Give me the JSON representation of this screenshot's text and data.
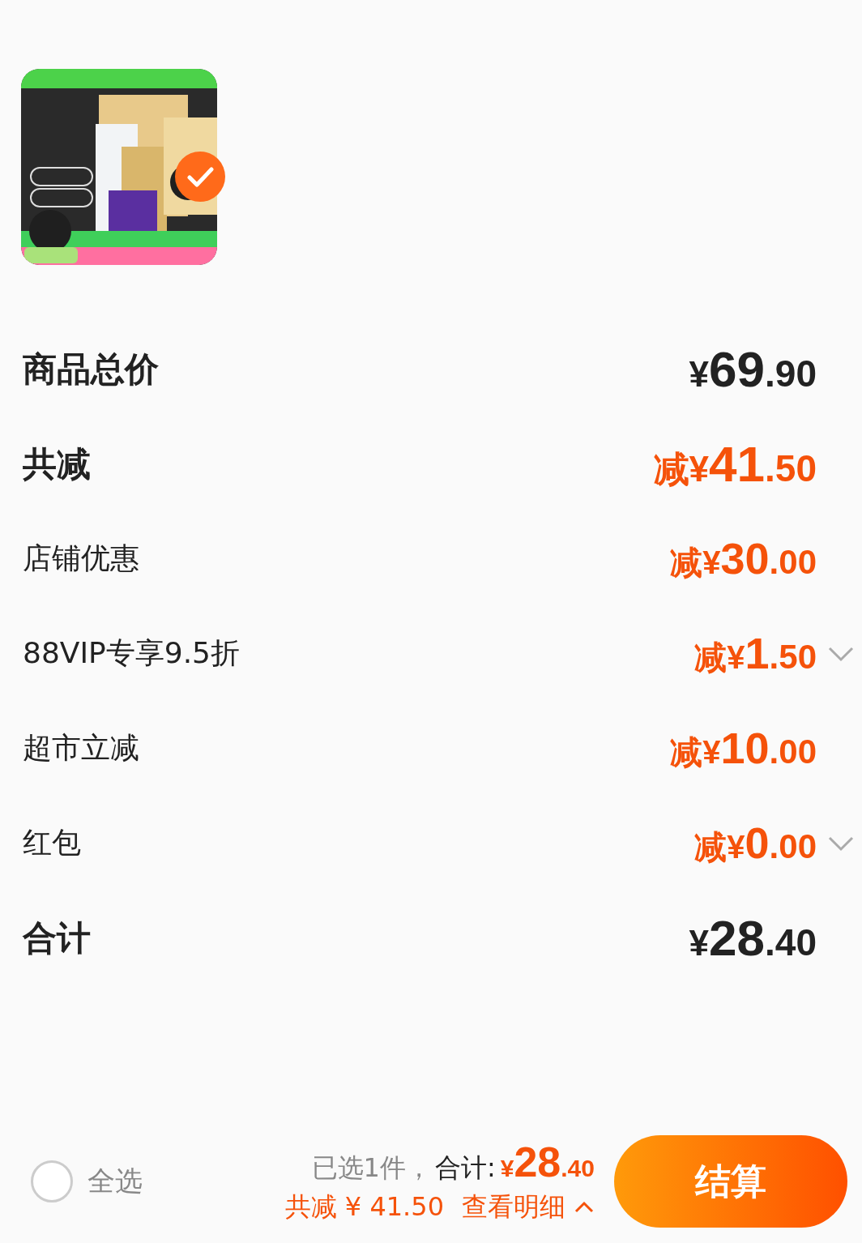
{
  "product": {
    "selected": true
  },
  "summary": [
    {
      "kind": "heading",
      "label": "商品总价",
      "value": "¥69.90",
      "discount": false,
      "expandable": false
    },
    {
      "kind": "heading",
      "label": "共减",
      "value": "减¥41.50",
      "discount": true,
      "expandable": false
    },
    {
      "kind": "item",
      "label": "店铺优惠",
      "value": "减¥30.00",
      "discount": true,
      "expandable": false
    },
    {
      "kind": "item",
      "label": "88VIP专享9.5折",
      "value": "减¥1.50",
      "discount": true,
      "expandable": true
    },
    {
      "kind": "item",
      "label": "超市立减",
      "value": "减¥10.00",
      "discount": true,
      "expandable": false
    },
    {
      "kind": "item",
      "label": "红包",
      "value": "减¥0.00",
      "discount": true,
      "expandable": true
    },
    {
      "kind": "heading",
      "label": "合计",
      "value": "¥28.40",
      "discount": false,
      "expandable": false
    }
  ],
  "footer": {
    "select_all": {
      "label": "全选",
      "checked": false
    },
    "selected_count": "已选1件，",
    "total_label": "合计:",
    "total": "¥28.40",
    "saving": "共减 ¥ 41.50",
    "details_link": "查看明细",
    "details_expanded": false,
    "checkout": "结算"
  }
}
